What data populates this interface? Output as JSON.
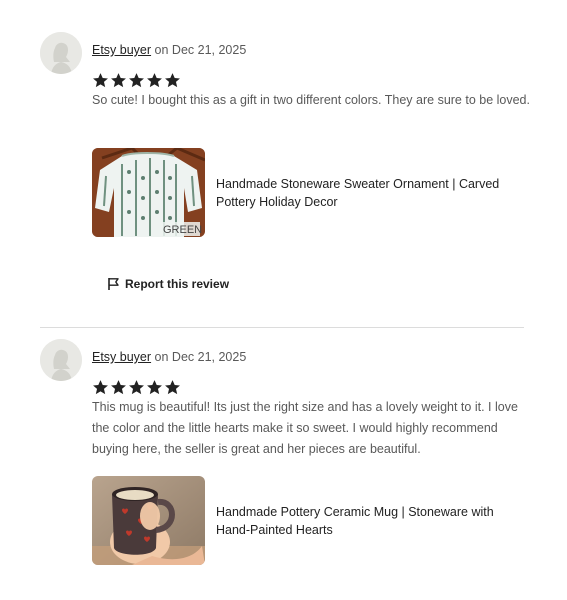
{
  "reviews": [
    {
      "author": "Etsy buyer",
      "date_text": "on Dec 21, 2025",
      "rating": 5,
      "text": "So cute! I bought this as a gift in two different colors. They are sure to be loved.",
      "product": {
        "title": "Handmade Stoneware Sweater Ornament | Carved Pottery Holiday Decor",
        "image_label": "GREEN"
      },
      "report_label": "Report this review"
    },
    {
      "author": "Etsy buyer",
      "date_text": "on Dec 21, 2025",
      "rating": 5,
      "text": "This mug is beautiful! Its just the right size and has a lovely weight to it. I love the color and the little hearts make it so sweet. I would highly recommend buying here, the seller is great and her pieces are beautiful.",
      "product": {
        "title": "Handmade Pottery Ceramic Mug | Stoneware with Hand-Painted Hearts"
      }
    }
  ],
  "colors": {
    "star": "#222222",
    "divider": "#dcdcdc",
    "body_text": "#595959"
  }
}
